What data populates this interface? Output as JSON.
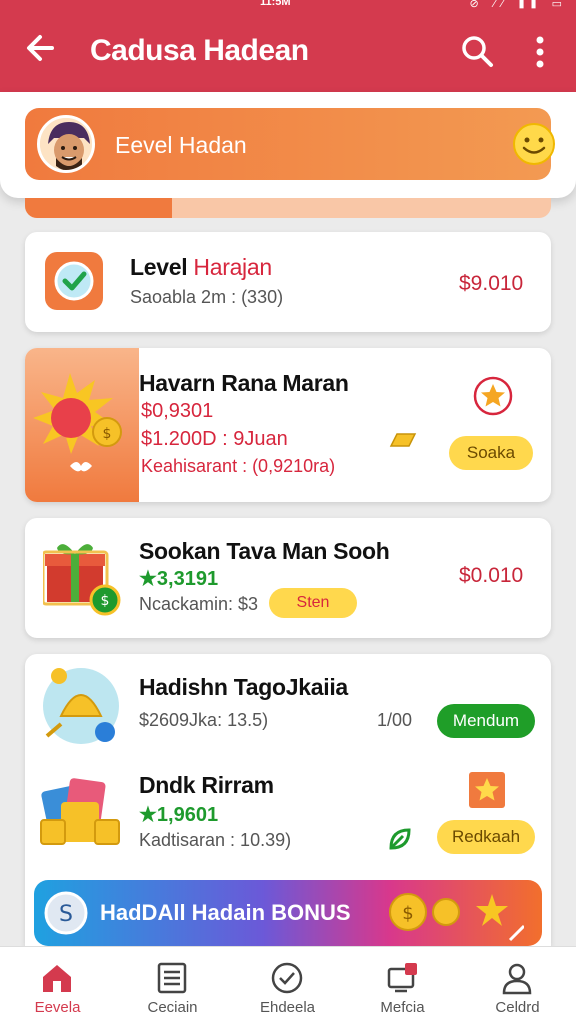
{
  "status_bar": {
    "time": "11:5M",
    "icons": "⊘ ⁄⁄ ▮▮ ▭"
  },
  "app_bar": {
    "title": "Cadusa Hadean",
    "back_icon": "arrow-left-icon",
    "search_icon": "search-icon",
    "menu_icon": "more-vert-icon"
  },
  "level": {
    "label": "Eevel Hadan",
    "progress_fraction": 0.28,
    "accent": "#f07a3e"
  },
  "cards": [
    {
      "name_part1": "Level ",
      "name_part2": "Harajan",
      "sub": "Saoabla 2m : (330)",
      "price": "$9.010"
    },
    {
      "name": "Havarn Rana Maran",
      "line1": "$0,9301",
      "line2": "$1.200D : 9Juan",
      "line3": "Keahisarant : (0,9210ra)",
      "button": "Soaka"
    },
    {
      "name": "Sookan Tava Man Sooh",
      "rating": "★3,3191",
      "sub": "Ncackamin: $3",
      "chip": "Sten",
      "price": "$0.010"
    }
  ],
  "rows": [
    {
      "name": "Hadishn TagoJkaiia",
      "sub": "$2609Jka: 13.5)",
      "count": "1/00",
      "button": "Mendum"
    },
    {
      "name": "Dndk Rirram",
      "rating": "★1,9601",
      "sub": "Kadtisaran : 10.39)",
      "button": "Redkaah"
    }
  ],
  "promo": {
    "label": "HadDAll Hadain BONUS"
  },
  "nav": [
    {
      "label": "Eevela",
      "icon": "home-icon",
      "active": true
    },
    {
      "label": "Ceciain",
      "icon": "document-icon",
      "active": false
    },
    {
      "label": "Ehdeela",
      "icon": "check-circle-icon",
      "active": false
    },
    {
      "label": "Mefcia",
      "icon": "inbox-icon",
      "active": false
    },
    {
      "label": "Celdrd",
      "icon": "profile-icon",
      "active": false
    }
  ],
  "colors": {
    "primary": "#d43a4e",
    "price": "#c8263a",
    "green": "#1e9a2d",
    "yellow": "#ffd84d"
  }
}
